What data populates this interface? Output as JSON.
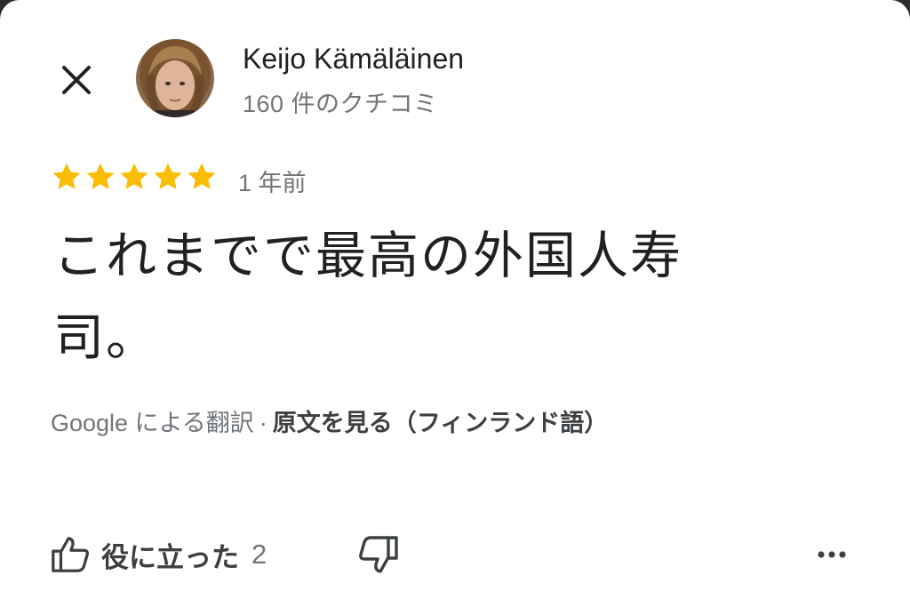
{
  "reviewer": {
    "name": "Keijo Kämäläinen",
    "review_count": "160 件のクチコミ"
  },
  "review": {
    "rating": 5,
    "rating_max": 5,
    "date": "1 年前",
    "text": "これまでで最高の外国人寿司。"
  },
  "translation": {
    "note": "Google による翻訳",
    "separator": "·",
    "original_link": "原文を見る（フィンランド語）"
  },
  "actions": {
    "helpful_label": "役に立った",
    "helpful_count": "2"
  },
  "icons": {
    "close": "close-icon",
    "star": "star-icon",
    "thumbs_up": "thumbs-up-icon",
    "thumbs_down": "thumbs-down-icon",
    "more": "more-horizontal-icon"
  },
  "colors": {
    "star": "#fbbc04",
    "text_primary": "#202124",
    "text_secondary": "#70757a",
    "text_strong": "#3c4043"
  }
}
